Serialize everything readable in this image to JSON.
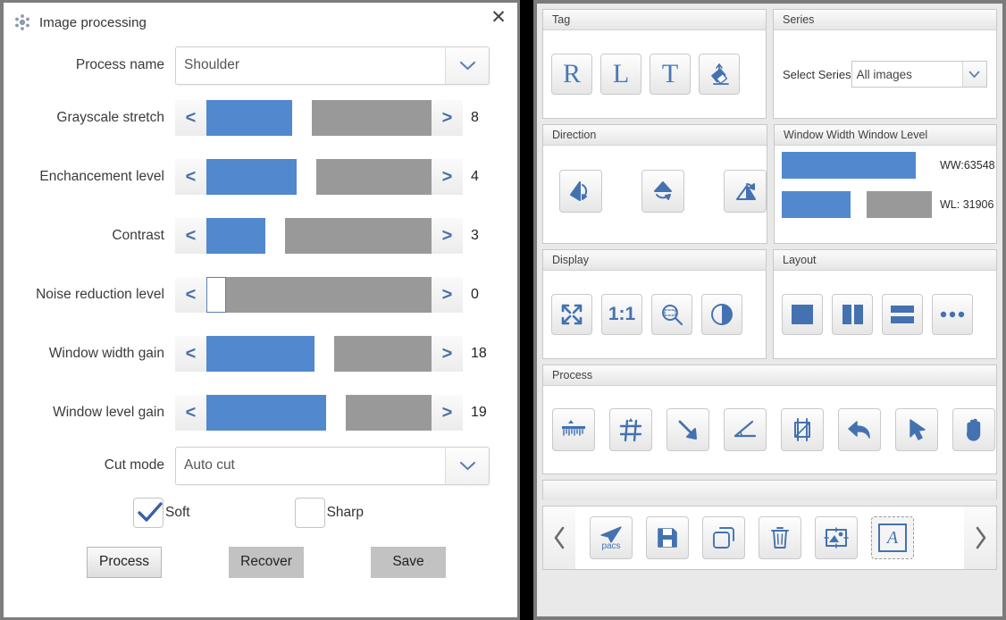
{
  "dialog": {
    "title": "Image processing",
    "title_icon": "gear-cluster-icon",
    "close_icon": "close-icon",
    "process_name": {
      "label": "Process name",
      "value": "Shoulder"
    },
    "cut_mode": {
      "label": "Cut mode",
      "value": "Auto cut"
    },
    "sliders": [
      {
        "label": "Grayscale stretch",
        "value": "8",
        "percent": 38
      },
      {
        "label": "Enchancement level",
        "value": "4",
        "percent": 40
      },
      {
        "label": "Contrast",
        "value": "3",
        "percent": 26
      },
      {
        "label": "Noise reduction level",
        "value": "0",
        "percent": 0
      },
      {
        "label": "Window width gain",
        "value": "18",
        "percent": 48
      },
      {
        "label": "Window level gain",
        "value": "19",
        "percent": 53
      }
    ],
    "checkboxes": [
      {
        "label": "Soft",
        "checked": true
      },
      {
        "label": "Sharp",
        "checked": false
      }
    ],
    "buttons": [
      {
        "label": "Process",
        "style": "primary"
      },
      {
        "label": "Recover",
        "style": "flat"
      },
      {
        "label": "Save",
        "style": "flat"
      }
    ]
  },
  "toolbox": {
    "tag": {
      "title": "Tag",
      "buttons": [
        {
          "label": "R",
          "name": "tag-right-button"
        },
        {
          "label": "L",
          "name": "tag-left-button"
        },
        {
          "label": "T",
          "name": "tag-text-button"
        },
        {
          "label": "",
          "name": "eraser-icon"
        }
      ]
    },
    "series": {
      "title": "Series",
      "select_label": "Select Series",
      "value": "All images"
    },
    "direction": {
      "title": "Direction",
      "buttons": [
        {
          "name": "flip-horizontal-icon"
        },
        {
          "name": "flip-vertical-icon"
        },
        {
          "name": "rotate-icon"
        }
      ]
    },
    "window": {
      "title": "Window Width Window Level",
      "ww": {
        "label": "WW:63548",
        "percent": 95
      },
      "wl": {
        "label": "WL: 31906",
        "percent": 48
      }
    },
    "display": {
      "title": "Display",
      "buttons": [
        {
          "name": "fit-screen-icon",
          "label": ""
        },
        {
          "name": "one-to-one-icon",
          "label": "1:1"
        },
        {
          "name": "magnifier-icon",
          "label": ""
        },
        {
          "name": "contrast-icon",
          "label": ""
        }
      ]
    },
    "layout": {
      "title": "Layout",
      "buttons": [
        {
          "name": "layout-single-icon"
        },
        {
          "name": "layout-two-columns-icon"
        },
        {
          "name": "layout-two-rows-icon"
        },
        {
          "name": "layout-more-icon"
        }
      ]
    },
    "process": {
      "title": "Process",
      "buttons": [
        {
          "name": "ruler-icon"
        },
        {
          "name": "grid-icon"
        },
        {
          "name": "arrow-annotation-icon"
        },
        {
          "name": "angle-icon"
        },
        {
          "name": "crop-icon"
        },
        {
          "name": "undo-icon"
        },
        {
          "name": "cursor-icon"
        },
        {
          "name": "pan-hand-icon"
        }
      ]
    },
    "bottom": {
      "prev_icon": "chevron-left-icon",
      "next_icon": "chevron-right-icon",
      "buttons": [
        {
          "name": "send-to-pacs-icon",
          "label": "pacs",
          "selected": false
        },
        {
          "name": "save-icon",
          "label": "",
          "selected": false
        },
        {
          "name": "copy-icon",
          "label": "",
          "selected": false
        },
        {
          "name": "delete-icon",
          "label": "",
          "selected": false
        },
        {
          "name": "image-edit-icon",
          "label": "",
          "selected": false
        },
        {
          "name": "annotate-text-icon",
          "label": "A",
          "selected": true
        }
      ]
    }
  },
  "colors": {
    "accent_blue": "#5288ce",
    "track_gray": "#999999",
    "icon_blue": "#4472b0"
  }
}
